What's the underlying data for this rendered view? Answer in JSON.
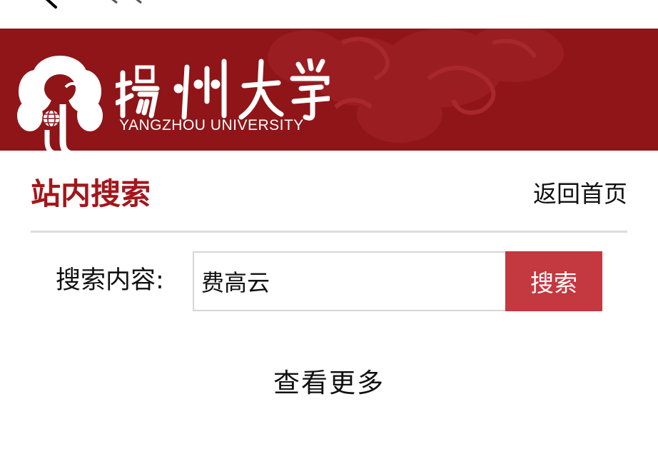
{
  "banner": {
    "logo_text": "揚州大学",
    "logo_subtitle": "YANGZHOU UNIVERSITY",
    "background_color": "#8f1518"
  },
  "heading": {
    "title": "站内搜索",
    "home_link": "返回首页",
    "accent_color": "#a3161b"
  },
  "search": {
    "label": "搜索内容:",
    "value": "费高云",
    "button_label": "搜索",
    "button_color": "#c4383f"
  },
  "results": {
    "more_link": "查看更多"
  },
  "icons": {
    "back": "back-arrow-icon",
    "emblem": "university-emblem-icon"
  }
}
